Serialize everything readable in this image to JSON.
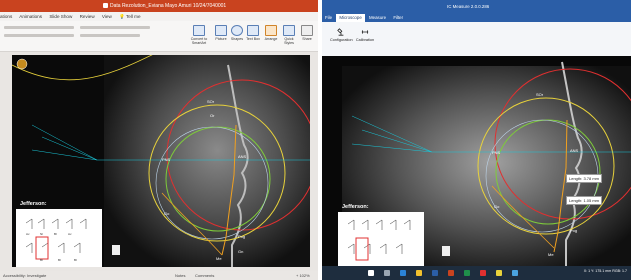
{
  "ppt": {
    "title": "Data Rezolution_Eviana Mayo Amuri 10/24/7040001",
    "tabs": [
      "ations",
      "Animations",
      "Slide Show",
      "Review",
      "View",
      "Tell me"
    ],
    "ribbon": {
      "picture": "Picture",
      "shapes": "Shapes",
      "textbox": "Text Box",
      "arrange": "Arrange",
      "quick": "Quick Styles",
      "convert": "Convert to SmartArt",
      "share": "Share"
    },
    "slide": {
      "label_jefferson": "Jefferson:",
      "landmarks": [
        "SOr",
        "PNS",
        "ANS",
        "Go",
        "Pog",
        "Me",
        "Gn",
        "Or"
      ],
      "chart_labels": [
        "Av",
        "Nl",
        "Bl",
        "Av",
        "Bl",
        "Bl",
        "BI"
      ]
    },
    "status": {
      "accessibility": "Accessibility: Investigate",
      "notes": "Notes",
      "comments": "Comments",
      "zoom": "+ 102%"
    }
  },
  "cs": {
    "title": "IC Measure 2.0.0.286",
    "tabs": [
      "File",
      "Microscope",
      "Measure",
      "Filter"
    ],
    "active_tab": "Microscope",
    "ribbon": {
      "configuration": "Configuration",
      "calibration": "Calibration"
    },
    "view": {
      "label_jefferson": "Jefferson:",
      "length1": "Length: 3.78 mm",
      "length2": "Length: 1.05 mm",
      "landmarks": [
        "SOr",
        "PNS",
        "ANS",
        "Go",
        "Pog",
        "Me"
      ]
    },
    "taskbar": {
      "status": "X: 1 Y: 175.1 mm   RGB: 1.7"
    }
  },
  "colors": {
    "ppt_accent": "#c9431f",
    "cs_accent": "#2b5ea7",
    "circle_red": "#e03030",
    "circle_yellow": "#e8d23b",
    "circle_green": "#7ecb3a",
    "tracing_orange": "#f0a020",
    "cyan_lines": "#19c6d8"
  }
}
